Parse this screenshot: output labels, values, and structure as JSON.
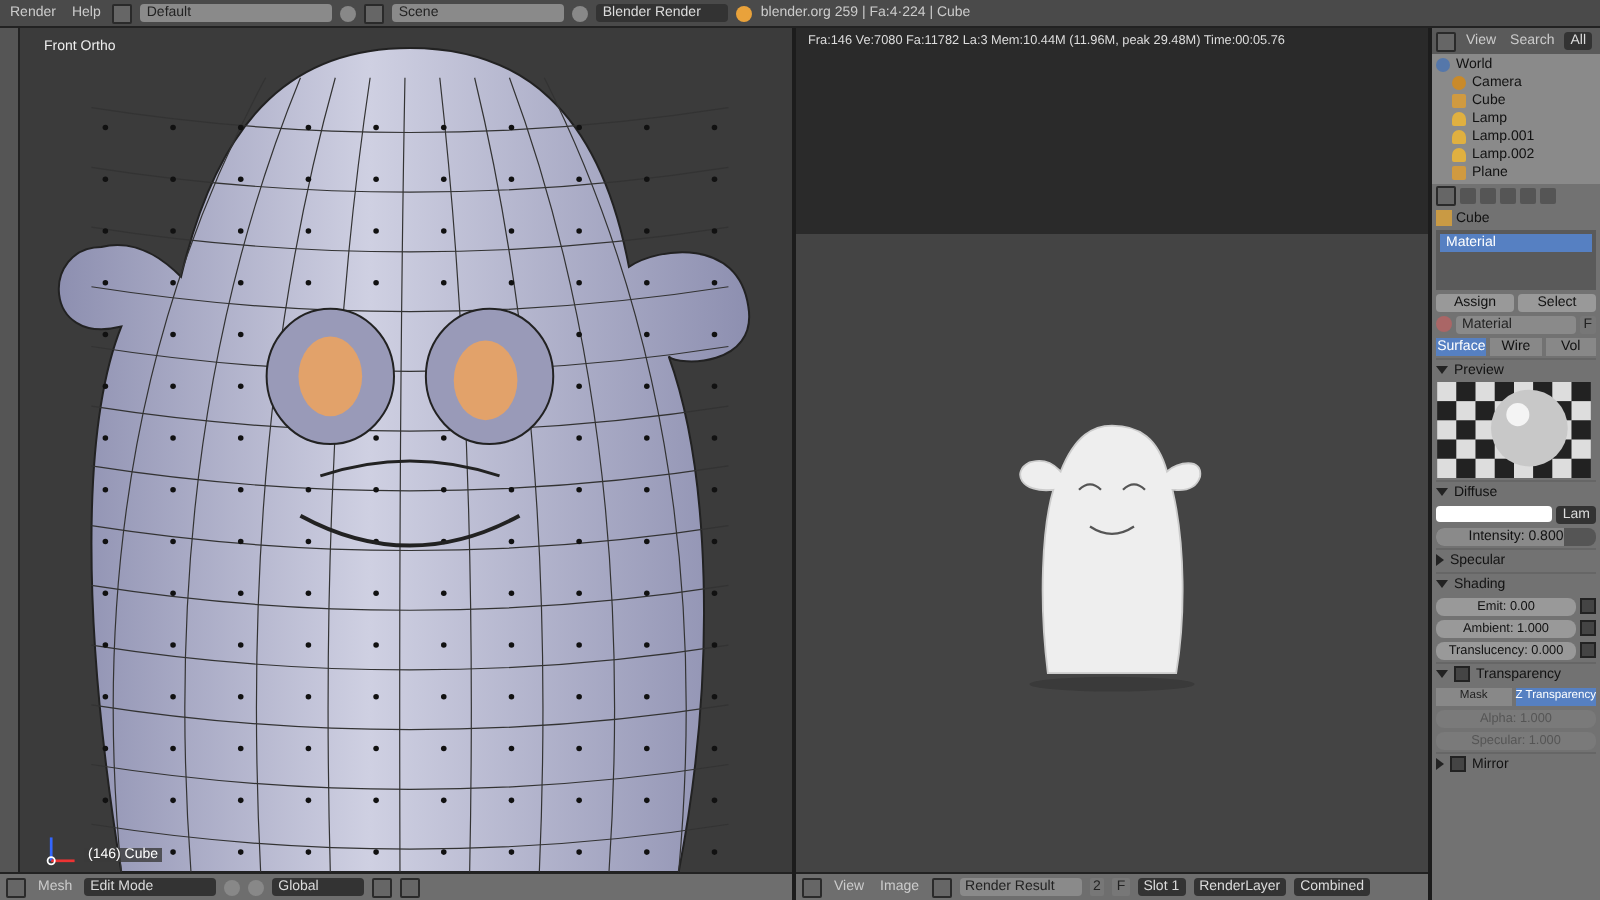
{
  "top_bar": {
    "menus": [
      "Render",
      "Help"
    ],
    "layout": "Default",
    "scene": "Scene",
    "engine": "Blender Render",
    "info": "blender.org 259 | Fa:4·224 | Cube"
  },
  "viewport": {
    "view_label": "Front Ortho",
    "object_label": "(146) Cube",
    "header": {
      "menu": "Mesh",
      "mode": "Edit Mode",
      "orientation": "Global"
    }
  },
  "image_editor": {
    "stats": "Fra:146  Ve:7080 Fa:11782 La:3 Mem:10.44M (11.96M, peak 29.48M) Time:00:05.76",
    "header": {
      "menus": [
        "View",
        "Image"
      ],
      "image": "Render Result",
      "users": "2",
      "fake": "F",
      "slot": "Slot 1",
      "layer": "RenderLayer",
      "pass": "Combined"
    }
  },
  "outliner": {
    "menus": [
      "View",
      "Search"
    ],
    "filter": "All",
    "items": [
      {
        "name": "World",
        "kind": "world"
      },
      {
        "name": "Camera",
        "kind": "camera"
      },
      {
        "name": "Cube",
        "kind": "mesh"
      },
      {
        "name": "Lamp",
        "kind": "lamp"
      },
      {
        "name": "Lamp.001",
        "kind": "lamp"
      },
      {
        "name": "Lamp.002",
        "kind": "lamp"
      },
      {
        "name": "Plane",
        "kind": "mesh"
      }
    ]
  },
  "properties": {
    "breadcrumb": "Cube",
    "slots": [
      {
        "name": "Material",
        "selected": true
      }
    ],
    "buttons": [
      "Assign",
      "Select"
    ],
    "material": "Material",
    "fake_user": "F",
    "tabs": [
      {
        "label": "Surface",
        "selected": true
      },
      {
        "label": "Wire",
        "selected": false
      },
      {
        "label": "Vol",
        "selected": false
      }
    ],
    "panels": [
      {
        "title": "Preview",
        "expanded": true,
        "kind": "preview"
      },
      {
        "title": "Diffuse",
        "expanded": true,
        "kind": "diffuse",
        "shader": "Lam",
        "intensity": {
          "label": "Intensity: 0.800",
          "level": 0.8
        }
      },
      {
        "title": "Specular",
        "expanded": false
      },
      {
        "title": "Shading",
        "expanded": true,
        "kind": "fields",
        "fields": [
          {
            "label": "Emit: 0.00",
            "disabled": false,
            "checked": false
          },
          {
            "label": "Ambient: 1.000",
            "disabled": false,
            "checked": false
          },
          {
            "label": "Translucency: 0.000",
            "disabled": false,
            "checked": false
          }
        ]
      },
      {
        "title": "Transparency",
        "expanded": true,
        "kind": "transparency",
        "checked": false,
        "modes": [
          {
            "label": "Mask",
            "selected": false
          },
          {
            "label": "Z Transparency",
            "selected": true
          }
        ],
        "fields": [
          {
            "label": "Alpha: 1.000",
            "disabled": true
          },
          {
            "label": "Specular: 1.000",
            "disabled": true
          }
        ]
      },
      {
        "title": "Mirror",
        "expanded": false,
        "checked": false
      }
    ]
  }
}
